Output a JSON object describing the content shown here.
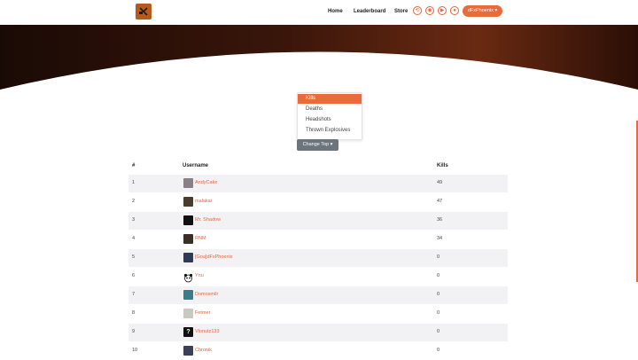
{
  "navbar": {
    "logo_alt": "Site logo",
    "links": [
      {
        "label": "Home"
      },
      {
        "label": "Leaderboard"
      },
      {
        "label": "Store"
      }
    ],
    "social_icons": [
      "steam-icon",
      "discord-icon",
      "youtube-icon",
      "reddit-icon"
    ],
    "user_button": "dFxPhoenix ▾"
  },
  "colors": {
    "accent": "#ea6a3b",
    "hero_dark": "#1a0a05",
    "hero_mid": "#5a2410",
    "button_gray": "#6c757d"
  },
  "top_menu": {
    "items": [
      {
        "label": "Kills",
        "active": true
      },
      {
        "label": "Deaths",
        "active": false
      },
      {
        "label": "Headshots",
        "active": false
      },
      {
        "label": "Thrown Explosives",
        "active": false
      }
    ],
    "change_button": "Change Top ▾"
  },
  "table": {
    "headers": {
      "rank": "#",
      "username": "Username",
      "kills": "Kills"
    },
    "rows": [
      {
        "rank": "1",
        "name": "AndyCake",
        "kills": "49",
        "avatar_color": "#8a7f86"
      },
      {
        "rank": "2",
        "name": "malakai",
        "kills": "47",
        "avatar_color": "#4a3b2a"
      },
      {
        "rank": "3",
        "name": "Mr. Shadow",
        "kills": "36",
        "avatar_color": "#111111"
      },
      {
        "rank": "4",
        "name": "RNM",
        "kills": "34",
        "avatar_color": "#3a2e25"
      },
      {
        "rank": "5",
        "name": "[Goa]dFxPhoenix",
        "kills": "0",
        "avatar_color": "#2f3b56"
      },
      {
        "rank": "6",
        "name": "Ynu",
        "kills": "0",
        "avatar_color": "#ffffff"
      },
      {
        "rank": "7",
        "name": "Domosmilr",
        "kills": "0",
        "avatar_color": "#3d7a8c"
      },
      {
        "rank": "8",
        "name": "Fetmer",
        "kills": "0",
        "avatar_color": "#c9c9c2"
      },
      {
        "rank": "9",
        "name": "Vlonutz133",
        "kills": "0",
        "avatar_color": "#111111"
      },
      {
        "rank": "10",
        "name": "Chronik",
        "kills": "0",
        "avatar_color": "#3b3f5a"
      }
    ]
  }
}
